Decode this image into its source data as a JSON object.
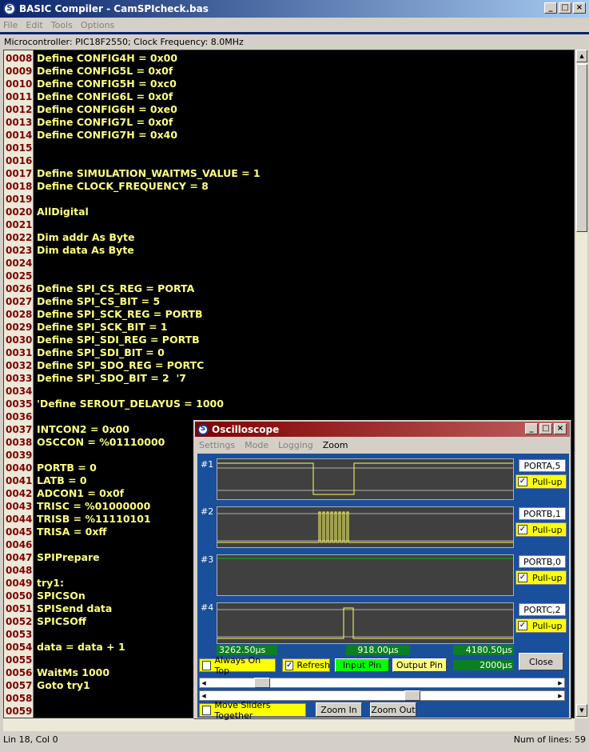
{
  "window": {
    "title": "BASIC Compiler - CamSPIcheck.bas"
  },
  "menu": [
    "File",
    "Edit",
    "Tools",
    "Options"
  ],
  "info": "Microcontroller: PIC18F2550;  Clock Frequency: 8.0MHz",
  "lines": [
    {
      "n": "0008",
      "c": "Define CONFIG4H = 0x00"
    },
    {
      "n": "0009",
      "c": "Define CONFIG5L = 0x0f"
    },
    {
      "n": "0010",
      "c": "Define CONFIG5H = 0xc0"
    },
    {
      "n": "0011",
      "c": "Define CONFIG6L = 0x0f"
    },
    {
      "n": "0012",
      "c": "Define CONFIG6H = 0xe0"
    },
    {
      "n": "0013",
      "c": "Define CONFIG7L = 0x0f"
    },
    {
      "n": "0014",
      "c": "Define CONFIG7H = 0x40"
    },
    {
      "n": "0015",
      "c": ""
    },
    {
      "n": "0016",
      "c": ""
    },
    {
      "n": "0017",
      "c": "Define SIMULATION_WAITMS_VALUE = 1"
    },
    {
      "n": "0018",
      "c": "Define CLOCK_FREQUENCY = 8"
    },
    {
      "n": "0019",
      "c": ""
    },
    {
      "n": "0020",
      "c": "AllDigital"
    },
    {
      "n": "0021",
      "c": ""
    },
    {
      "n": "0022",
      "c": "Dim addr As Byte"
    },
    {
      "n": "0023",
      "c": "Dim data As Byte"
    },
    {
      "n": "0024",
      "c": ""
    },
    {
      "n": "0025",
      "c": ""
    },
    {
      "n": "0026",
      "c": "Define SPI_CS_REG = PORTA"
    },
    {
      "n": "0027",
      "c": "Define SPI_CS_BIT = 5"
    },
    {
      "n": "0028",
      "c": "Define SPI_SCK_REG = PORTB"
    },
    {
      "n": "0029",
      "c": "Define SPI_SCK_BIT = 1"
    },
    {
      "n": "0030",
      "c": "Define SPI_SDI_REG = PORTB"
    },
    {
      "n": "0031",
      "c": "Define SPI_SDI_BIT = 0"
    },
    {
      "n": "0032",
      "c": "Define SPI_SDO_REG = PORTC"
    },
    {
      "n": "0033",
      "c": "Define SPI_SDO_BIT = 2  '7"
    },
    {
      "n": "0034",
      "c": ""
    },
    {
      "n": "0035",
      "c": "'Define SEROUT_DELAYUS = 1000"
    },
    {
      "n": "0036",
      "c": ""
    },
    {
      "n": "0037",
      "c": "INTCON2 = 0x00"
    },
    {
      "n": "0038",
      "c": "OSCCON = %01110000"
    },
    {
      "n": "0039",
      "c": ""
    },
    {
      "n": "0040",
      "c": "PORTB = 0"
    },
    {
      "n": "0041",
      "c": "LATB = 0"
    },
    {
      "n": "0042",
      "c": "ADCON1 = 0x0f"
    },
    {
      "n": "0043",
      "c": "TRISC = %01000000"
    },
    {
      "n": "0044",
      "c": "TRISB = %11110101"
    },
    {
      "n": "0045",
      "c": "TRISA = 0xff"
    },
    {
      "n": "0046",
      "c": ""
    },
    {
      "n": "0047",
      "c": "SPIPrepare"
    },
    {
      "n": "0048",
      "c": ""
    },
    {
      "n": "0049",
      "c": "try1:"
    },
    {
      "n": "0050",
      "c": "SPICSOn"
    },
    {
      "n": "0051",
      "c": "SPISend data"
    },
    {
      "n": "0052",
      "c": "SPICSOff"
    },
    {
      "n": "0053",
      "c": ""
    },
    {
      "n": "0054",
      "c": "data = data + 1"
    },
    {
      "n": "0055",
      "c": ""
    },
    {
      "n": "0056",
      "c": "WaitMs 1000"
    },
    {
      "n": "0057",
      "c": "Goto try1"
    },
    {
      "n": "0058",
      "c": ""
    },
    {
      "n": "0059",
      "c": ""
    }
  ],
  "status": {
    "left": "Lin 18, Col 0",
    "right": "Num of lines: 59"
  },
  "oscilloscope": {
    "title": "Oscilloscope",
    "menu": [
      "Settings",
      "Mode",
      "Logging",
      "Zoom"
    ],
    "channels": [
      {
        "label": "#1",
        "pin": "PORTA,5",
        "pullup": "Pull-up"
      },
      {
        "label": "#2",
        "pin": "PORTB,1",
        "pullup": "Pull-up"
      },
      {
        "label": "#3",
        "pin": "PORTB,0",
        "pullup": "Pull-up"
      },
      {
        "label": "#4",
        "pin": "PORTC,2",
        "pullup": "Pull-up"
      }
    ],
    "time_left": "3262.50µs",
    "time_mid": "918.00µs",
    "time_right": "4180.50µs",
    "time_div": "2000µs",
    "always_on_top": "Always On Top",
    "refresh": "Refresh",
    "input_pin": "Input Pin",
    "output_pin": "Output Pin",
    "close": "Close",
    "move_sliders": "Move Sliders Together",
    "zoom_in": "Zoom In",
    "zoom_out": "Zoom Out",
    "colors": {
      "trace": "#ffff60",
      "grid": "#b0b0b0",
      "low_line": "#00c000"
    }
  }
}
